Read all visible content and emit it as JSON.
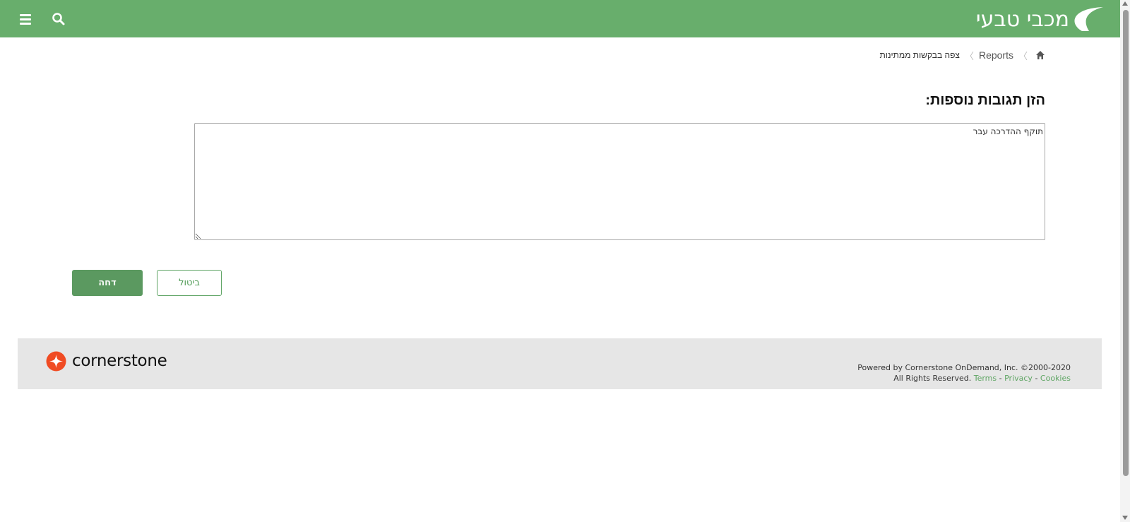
{
  "header": {
    "brand_name": "מכבי טבעי",
    "brand_color": "#68ae6c",
    "menu_icon": "hamburger-menu-icon",
    "search_icon": "search-icon"
  },
  "breadcrumb": {
    "home_icon": "home-icon",
    "items": [
      {
        "label": "Reports"
      },
      {
        "label": "צפה בבקשות ממתינות"
      }
    ]
  },
  "form": {
    "title": "הזן תגובות נוספות:",
    "comments_value": "תוקף ההדרכה עבר"
  },
  "actions": {
    "reject_label": "דחה",
    "cancel_label": "ביטול",
    "primary_color": "#5b9960"
  },
  "footer": {
    "brand": "cornerstone",
    "brand_mark_color": "#f04b23",
    "powered_by": "Powered by Cornerstone OnDemand, Inc. ©2000-2020",
    "rights": "All Rights Reserved.",
    "links": {
      "terms": "Terms",
      "privacy": "Privacy",
      "cookies": "Cookies"
    },
    "separator": "-"
  }
}
